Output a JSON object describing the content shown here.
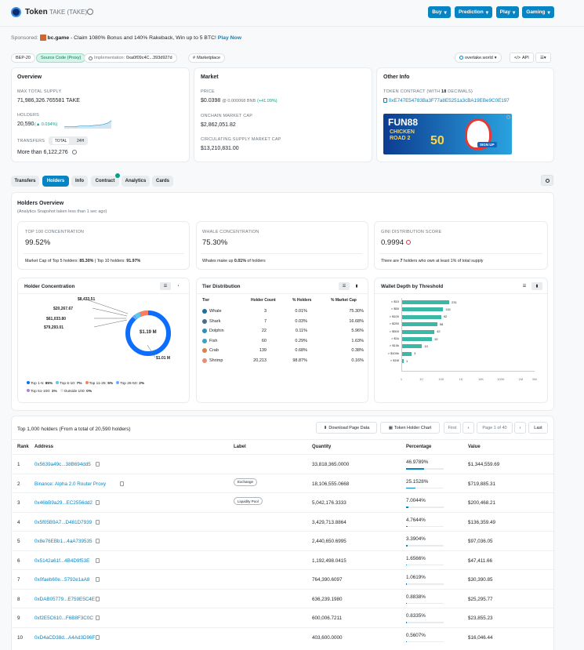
{
  "header": {
    "title": "Token",
    "token": "TAKE (TAKE)",
    "nav": [
      "Buy",
      "Prediction",
      "Play",
      "Gaming"
    ]
  },
  "sponsor": {
    "label": "Sponsored:",
    "site": "bc.game",
    "text": " - Claim 1080% Bonus and 140% Rakeback, Win up to 5 BTC!",
    "cta": "Play Now"
  },
  "chips": {
    "bep": "BEP-20",
    "source": "Source Code (Proxy)",
    "impl_label": "Implementation:",
    "impl_addr": "0xa0f09c4C...393d927d",
    "market": "Marketplace",
    "site": "overtake.world",
    "api": "API"
  },
  "overview": {
    "title": "Overview",
    "max_label": "MAX TOTAL SUPPLY",
    "max_value": "71,986,326.765581 TAKE",
    "holders_label": "HOLDERS",
    "holders_value": "20,590",
    "holders_change": "(▲ 0.034%)",
    "transfers_label": "TRANSFERS",
    "toggle_total": "TOTAL",
    "toggle_24h": "24H",
    "transfers_value": "More than 6,122,276"
  },
  "market": {
    "title": "Market",
    "price_label": "PRICE",
    "price": "$0.0398",
    "price_bnb": "@ 0.000068 BNB",
    "price_change": "(+41.09%)",
    "cap_label": "ONCHAIN MARKET CAP",
    "cap": "$2,862,051.82",
    "csupply_label": "CIRCULATING SUPPLY MARKET CAP",
    "csupply": "$13,210,831.00"
  },
  "other": {
    "title": "Other Info",
    "contract_label": "TOKEN CONTRACT (WITH",
    "decimals": "18",
    "decimals_suffix": "DECIMALS)",
    "contract": "0xE747E54783Ba3F77a8E5251a3cBA19EBe9C0E197",
    "ad_brand": "FUN88",
    "ad_game": "CHICKEN ROAD 2",
    "ad_num": "50",
    "ad_cta": "SIGN UP"
  },
  "tabs": [
    "Transfers",
    "Holders",
    "Info",
    "Contract",
    "Analytics",
    "Cards"
  ],
  "holders_overview": {
    "title": "Holders Overview",
    "subtitle": "(Analytics Snapshot taken less than 1 sec ago)",
    "top100_label": "TOP 100 CONCENTRATION",
    "top100": "99.52%",
    "top100_note_a": "Market Cap of Top 5 holders: ",
    "top100_note_b": "85.30%",
    "top100_note_c": " | Top 10 holders: ",
    "top100_note_d": "91.97%",
    "whale_label": "WHALE CONCENTRATION",
    "whale": "75.30%",
    "whale_note_a": "Whales make up ",
    "whale_note_b": "0.01%",
    "whale_note_c": " of holders",
    "gini_label": "GINI DISTRIBUTION SCORE",
    "gini": "0.9994",
    "gini_note_a": "There are ",
    "gini_note_b": "7",
    "gini_note_c": " holders who own at least 1% of total supply"
  },
  "concentration": {
    "title": "Holder Concentration",
    "labels": [
      "$8,433.51",
      "$20,267.67",
      "$61,033.80",
      "$79,293.01"
    ],
    "center": "$1.19 M",
    "right": "$1.01 M",
    "legend": [
      {
        "name": "Top 1-5:",
        "pct": "85%",
        "color": "#0d6efd"
      },
      {
        "name": "Top 6-10:",
        "pct": "7%",
        "color": "#5dc8e8"
      },
      {
        "name": "Top 11-25:",
        "pct": "5%",
        "color": "#fd7e5c"
      },
      {
        "name": "Top 26-50:",
        "pct": "2%",
        "color": "#6ea8fe"
      },
      {
        "name": "Top 51-100:",
        "pct": "1%",
        "color": "#b87fd9"
      },
      {
        "name": "Outside 100:",
        "pct": "0%",
        "color": "#dee2e6"
      }
    ]
  },
  "tiers": {
    "title": "Tier Distribution",
    "headers": [
      "Tier",
      "Holder Count",
      "% Holders",
      "% Market Cap"
    ],
    "rows": [
      [
        "Whale",
        "3",
        "0.01%",
        "75.30%"
      ],
      [
        "Shark",
        "7",
        "0.03%",
        "16.68%"
      ],
      [
        "Dolphin",
        "22",
        "0.11%",
        "5.96%"
      ],
      [
        "Fish",
        "60",
        "0.29%",
        "1.63%"
      ],
      [
        "Crab",
        "139",
        "0.68%",
        "0.38%"
      ],
      [
        "Shrimp",
        "20,213",
        "98.87%",
        "0.16%"
      ]
    ]
  },
  "wallet": {
    "title": "Wallet Depth by Threshold",
    "axis": [
      "1",
      "10",
      "100",
      "1K",
      "10K",
      "100K",
      "1M",
      "5M"
    ]
  },
  "chart_data": {
    "type": "bar",
    "title": "Wallet Depth by Threshold",
    "categories": [
      "> $10",
      "> $50",
      "> $100",
      "> $250",
      "> $500",
      "> $1k",
      "> $10k",
      "> $100k",
      "> $1M"
    ],
    "values": [
      231,
      115,
      92,
      58,
      42,
      32,
      10,
      3,
      1
    ],
    "log_scale": true,
    "orientation": "horizontal"
  },
  "top": {
    "title": "Top 1,000 holders (From a total of 20,590 holders)",
    "download": "Download Page Data",
    "chart": "Token Holder Chart",
    "first": "First",
    "page": "Page 1 of 40",
    "last": "Last",
    "headers": [
      "Rank",
      "Address",
      "Label",
      "Quantity",
      "Percentage",
      "Value"
    ],
    "rows": [
      {
        "rank": "1",
        "addr": "0x5639a49c...38B694dd5",
        "label": "",
        "qty": "33,818,365.0000",
        "pct": "46.9789%",
        "frac": 0.47,
        "val": "$1,344,559.69"
      },
      {
        "rank": "2",
        "addr": "Binance: Alpha 2.0 Router Proxy",
        "label": "Exchange",
        "qty": "18,106,555.0668",
        "pct": "25.1528%",
        "frac": 0.2515,
        "val": "$719,885.31"
      },
      {
        "rank": "3",
        "addr": "0x46bB9a29...EC2556dd2",
        "label": "Liquidity Pool",
        "qty": "5,042,176.3333",
        "pct": "7.0044%",
        "frac": 0.07,
        "val": "$200,468.21"
      },
      {
        "rank": "4",
        "addr": "0x5f05B9A7...D481D7939",
        "label": "",
        "qty": "3,429,713.8864",
        "pct": "4.7644%",
        "frac": 0.0476,
        "val": "$136,359.49"
      },
      {
        "rank": "5",
        "addr": "0x8e76EBb1...4aA739535",
        "label": "",
        "qty": "2,440,650.6995",
        "pct": "3.3904%",
        "frac": 0.0339,
        "val": "$97,036.05"
      },
      {
        "rank": "6",
        "addr": "0x5142a61f...4B4D9f53E",
        "label": "",
        "qty": "1,192,498.0415",
        "pct": "1.6566%",
        "frac": 0.0166,
        "val": "$47,411.66"
      },
      {
        "rank": "7",
        "addr": "0x0faeb60e...5792e1aA8",
        "label": "",
        "qty": "764,390.6097",
        "pct": "1.0619%",
        "frac": 0.0106,
        "val": "$30,390.85"
      },
      {
        "rank": "8",
        "addr": "0xDAB05779...E759E5C4E",
        "label": "",
        "qty": "636,239.1980",
        "pct": "0.8838%",
        "frac": 0.0088,
        "val": "$25,295.77"
      },
      {
        "rank": "9",
        "addr": "0xf2E5C610...F6B8F3C0C",
        "label": "",
        "qty": "600,006.7211",
        "pct": "0.8335%",
        "frac": 0.0083,
        "val": "$23,855.23"
      },
      {
        "rank": "10",
        "addr": "0xD4aCD38d...A4Ad3D96F",
        "label": "",
        "qty": "403,600.0000",
        "pct": "0.5607%",
        "frac": 0.0056,
        "val": "$16,046.44"
      }
    ]
  }
}
